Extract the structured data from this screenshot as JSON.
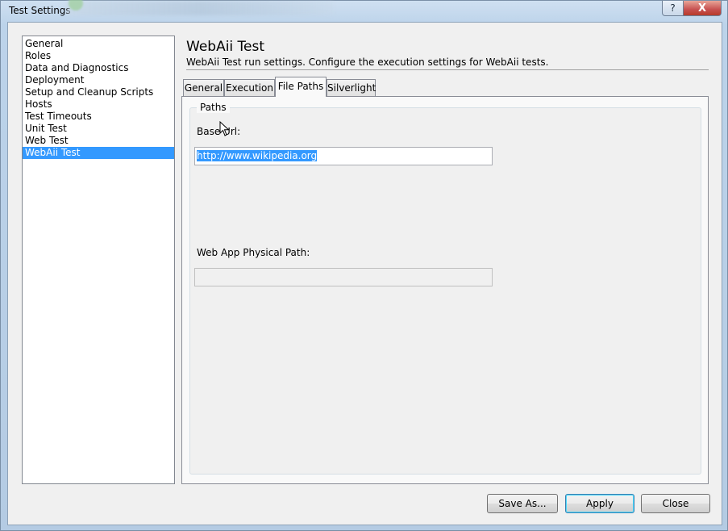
{
  "window": {
    "title": "Test Settings",
    "help_label": "?",
    "close_label": "X"
  },
  "nav": {
    "items": [
      {
        "label": "General"
      },
      {
        "label": "Roles"
      },
      {
        "label": "Data and Diagnostics"
      },
      {
        "label": "Deployment"
      },
      {
        "label": "Setup and Cleanup Scripts"
      },
      {
        "label": "Hosts"
      },
      {
        "label": "Test Timeouts"
      },
      {
        "label": "Unit Test"
      },
      {
        "label": "Web Test"
      },
      {
        "label": "WebAii Test"
      }
    ],
    "selected": "WebAii Test"
  },
  "content": {
    "title": "WebAii Test",
    "description": "WebAii Test run settings. Configure the execution settings for WebAii tests."
  },
  "tabs": [
    {
      "label": "General"
    },
    {
      "label": "Execution"
    },
    {
      "label": "File Paths"
    },
    {
      "label": "Silverlight"
    }
  ],
  "active_tab": "File Paths",
  "paths": {
    "legend": "Paths",
    "base_url_label": "Base Url:",
    "base_url_value": "http://www.wikipedia.org",
    "physical_path_label": "Web App Physical Path:",
    "physical_path_value": ""
  },
  "buttons": {
    "save_as": "Save As...",
    "apply": "Apply",
    "close": "Close"
  },
  "colors": {
    "selection": "#3399ff",
    "dialog_bg": "#f0f0f0",
    "frame": "#bcd3ea"
  }
}
